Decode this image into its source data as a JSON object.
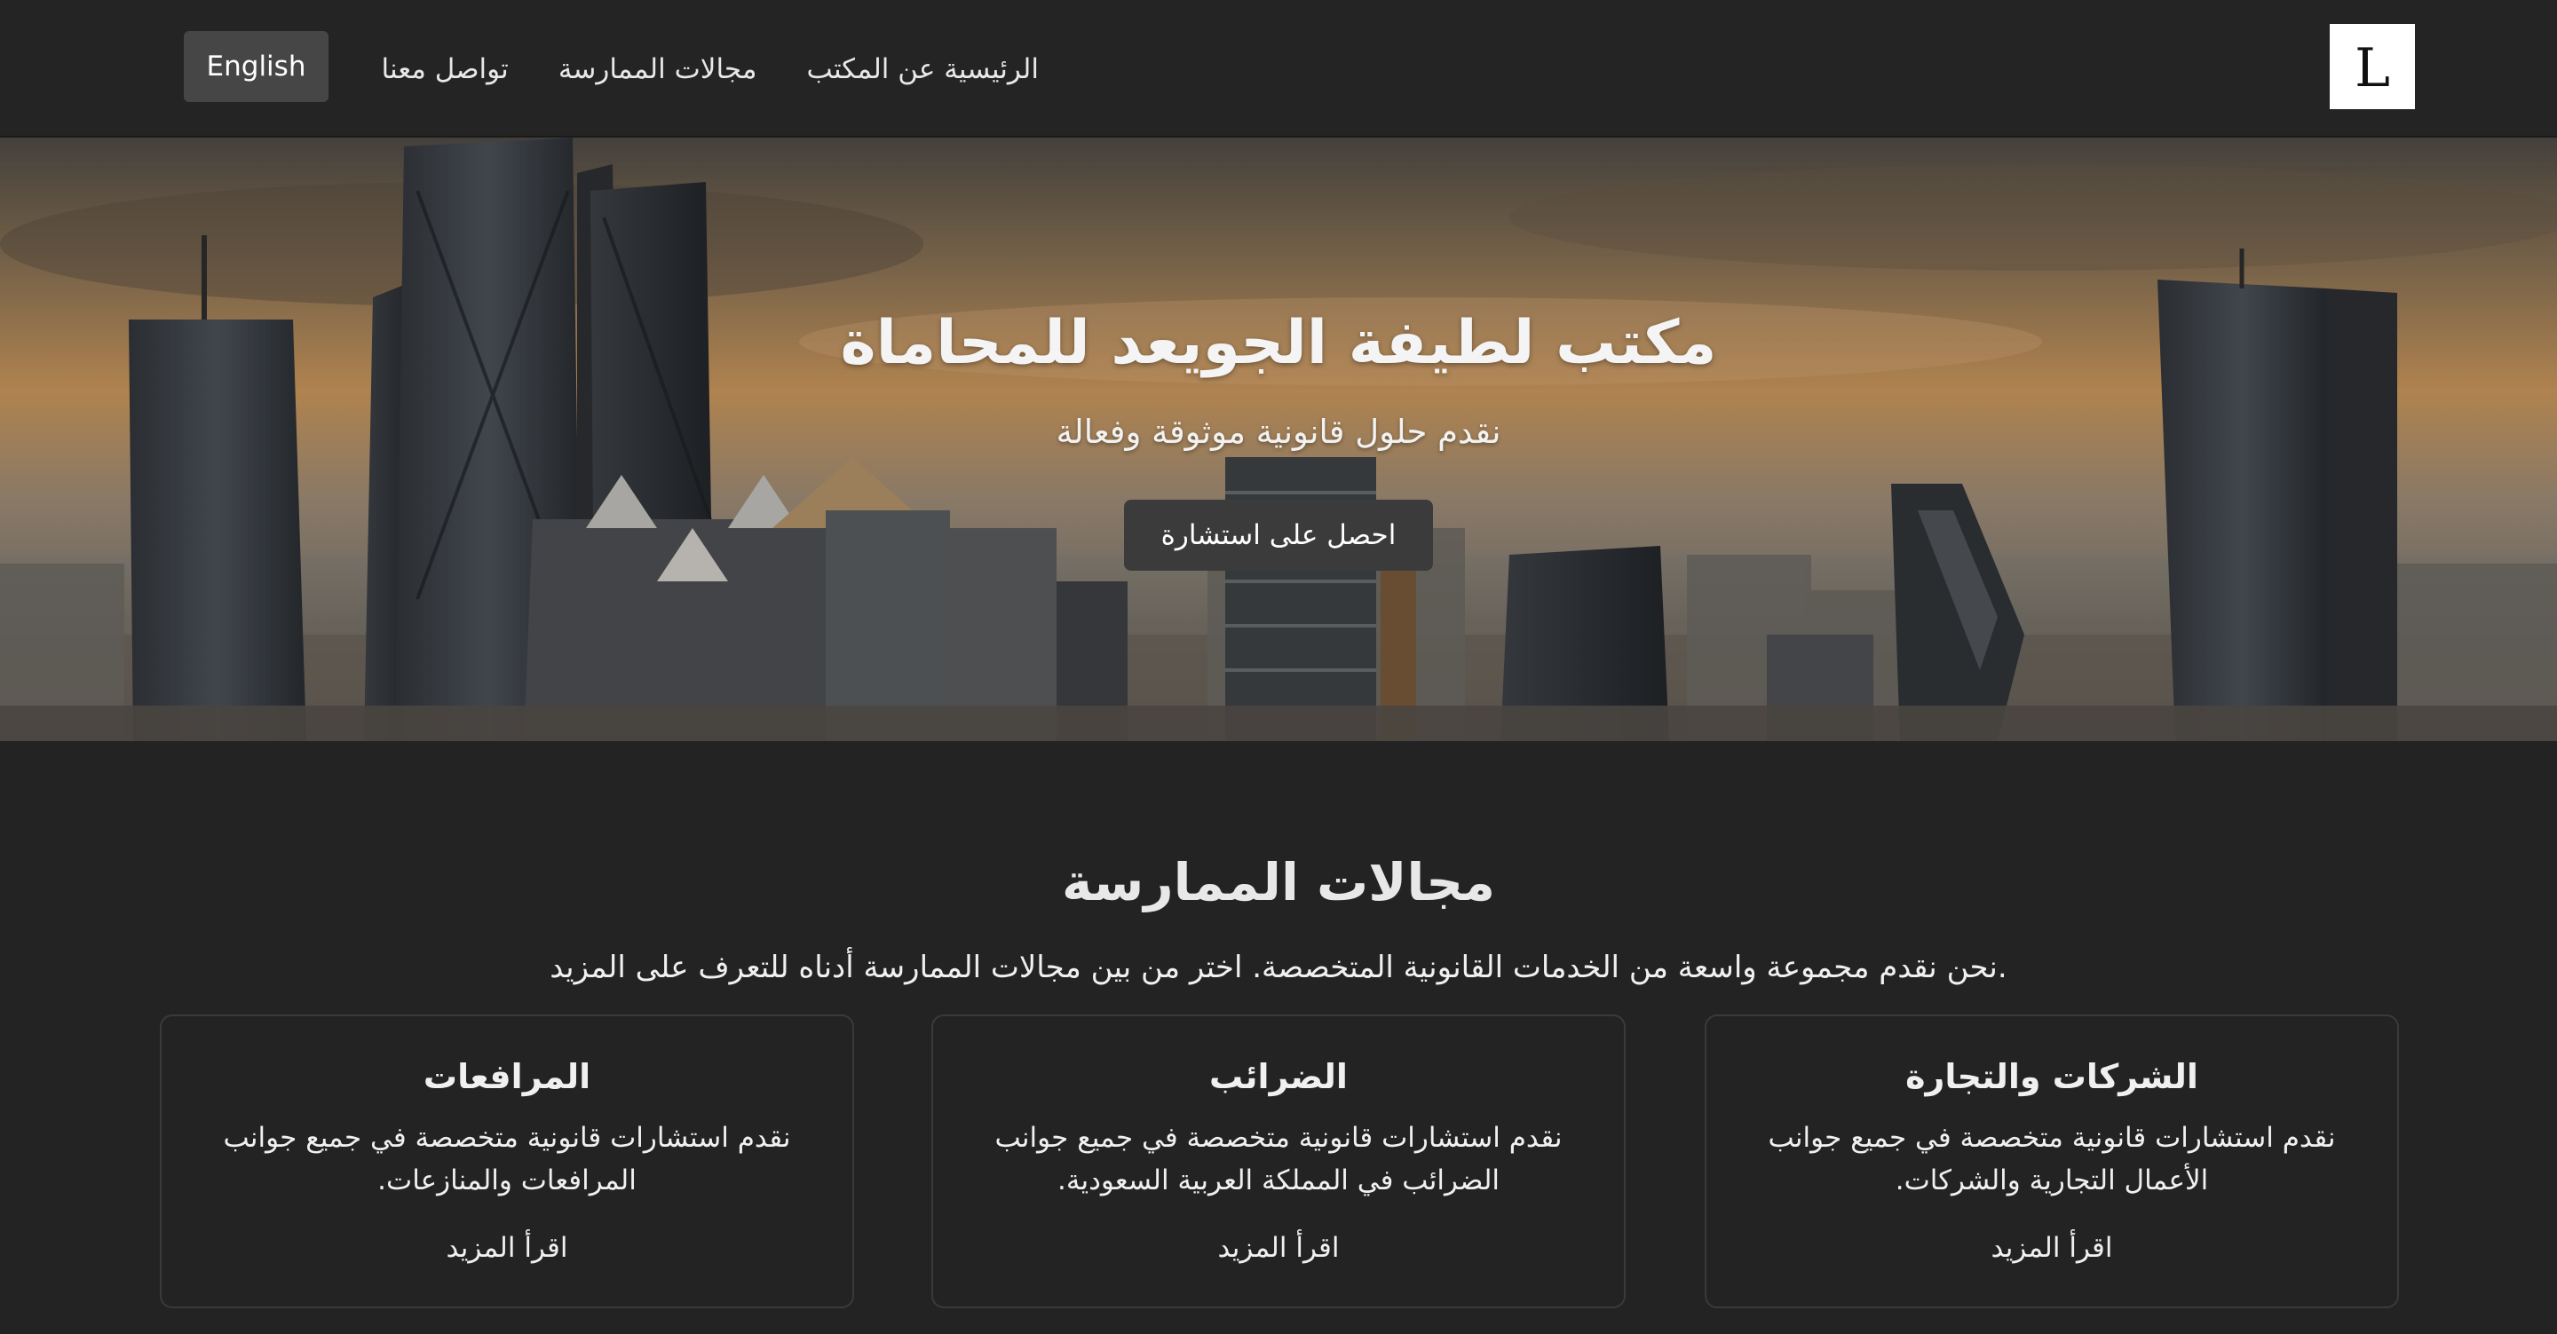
{
  "navbar": {
    "logo_letter": "L",
    "links": {
      "home_about": "الرئيسية عن المكتب",
      "practice_areas": "مجالات الممارسة",
      "contact": "تواصل معنا"
    },
    "language_button": "English"
  },
  "hero": {
    "title": "مكتب لطيفة الجويعد للمحاماة",
    "subtitle": "نقدم حلول قانونية موثوقة وفعالة",
    "cta_label": "احصل على استشارة"
  },
  "practice": {
    "title": "مجالات الممارسة",
    "description": "نحن نقدم مجموعة واسعة من الخدمات القانونية المتخصصة. اختر من بين مجالات الممارسة أدناه للتعرف على المزيد.",
    "cards": [
      {
        "title": "الشركات والتجارة",
        "description": "نقدم استشارات قانونية متخصصة في جميع جوانب الأعمال التجارية والشركات.",
        "link": "اقرأ المزيد"
      },
      {
        "title": "الضرائب",
        "description": "نقدم استشارات قانونية متخصصة في جميع جوانب الضرائب في المملكة العربية السعودية.",
        "link": "اقرأ المزيد"
      },
      {
        "title": "المرافعات",
        "description": "نقدم استشارات قانونية متخصصة في جميع جوانب المرافعات والمنازعات.",
        "link": "اقرأ المزيد"
      }
    ]
  },
  "colors": {
    "background": "#232323",
    "navbar": "#242424",
    "button": "#3b3b3b",
    "text": "#f0f0f0"
  }
}
